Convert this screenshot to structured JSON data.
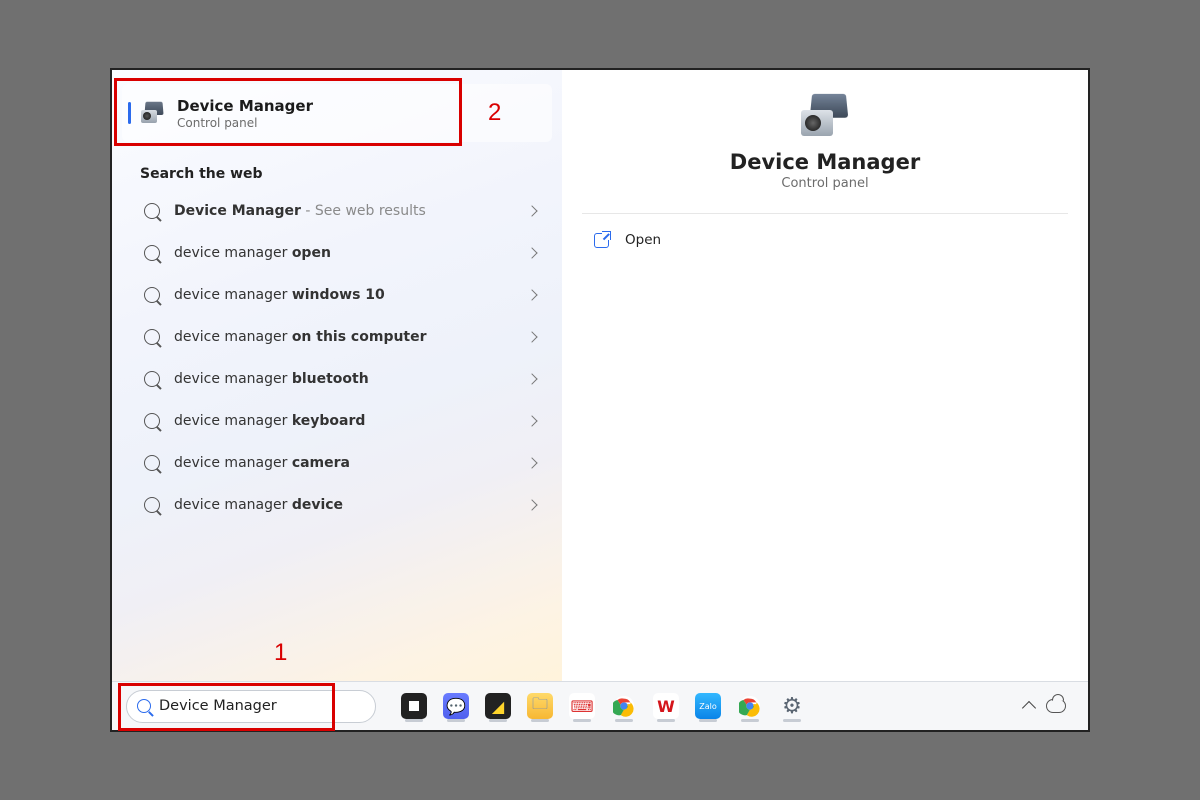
{
  "best_match": {
    "title": "Device Manager",
    "subtitle": "Control panel"
  },
  "callouts": {
    "num1": "1",
    "num2": "2"
  },
  "web_header": "Search the web",
  "web_results": [
    {
      "prefix": "",
      "mid": "Device Manager",
      "suffix": " - See web results",
      "suffix_gray": true
    },
    {
      "prefix": "device manager ",
      "mid": "open",
      "suffix": ""
    },
    {
      "prefix": "device manager ",
      "mid": "windows 10",
      "suffix": ""
    },
    {
      "prefix": "device manager ",
      "mid": "on this computer",
      "suffix": ""
    },
    {
      "prefix": "device manager ",
      "mid": "bluetooth",
      "suffix": ""
    },
    {
      "prefix": "device manager ",
      "mid": "keyboard",
      "suffix": ""
    },
    {
      "prefix": "device manager ",
      "mid": "camera",
      "suffix": ""
    },
    {
      "prefix": "device manager ",
      "mid": "device",
      "suffix": ""
    }
  ],
  "detail": {
    "title": "Device Manager",
    "subtitle": "Control panel",
    "open_label": "Open"
  },
  "search_value": "Device Manager",
  "taskbar": [
    {
      "name": "task-view",
      "bg": "#222",
      "fg": "#fff",
      "glyph": "",
      "inner": "<div style='width:10px;height:10px;background:#fff;margin:1px'></div>"
    },
    {
      "name": "app-chat",
      "bg": "linear-gradient(#6a7cff,#5060ee)",
      "fg": "#fff",
      "glyph": "💬"
    },
    {
      "name": "app-note",
      "bg": "#222",
      "fg": "#ffd52b",
      "glyph": "◢"
    },
    {
      "name": "file-explorer",
      "bg": "linear-gradient(#ffda6a,#f7b733)",
      "fg": "#4a79d4",
      "glyph": "🗀"
    },
    {
      "name": "app-unikey",
      "bg": "#fff",
      "fg": "#d33",
      "glyph": "⌨"
    },
    {
      "name": "chrome",
      "bg": "#fff",
      "fg": "",
      "glyph": "",
      "svg": "chrome"
    },
    {
      "name": "wps",
      "bg": "#fff",
      "fg": "#d4151b",
      "glyph": "W",
      "bold": true
    },
    {
      "name": "zalo",
      "bg": "linear-gradient(#33b8ff,#0a84e8)",
      "fg": "#fff",
      "glyph": "Zalo",
      "fs": "8px"
    },
    {
      "name": "chrome2",
      "bg": "#fff",
      "fg": "",
      "glyph": "",
      "svg": "chrome"
    },
    {
      "name": "settings",
      "bg": "transparent",
      "fg": "#5a6572",
      "glyph": "⚙",
      "fs": "22px"
    }
  ]
}
